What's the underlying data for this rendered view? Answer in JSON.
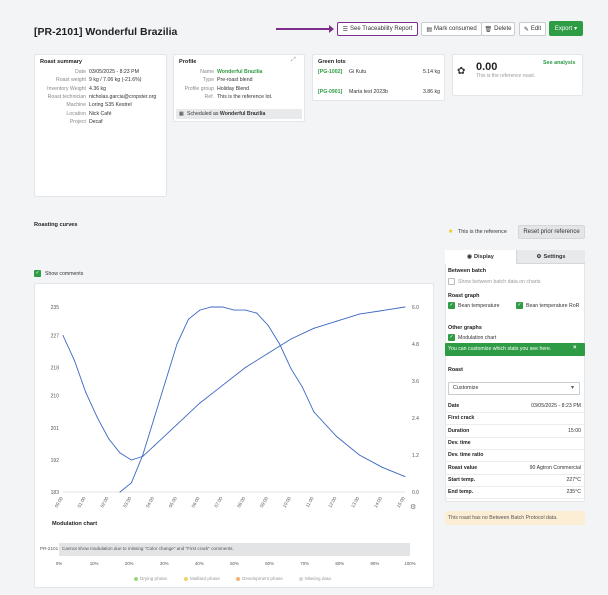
{
  "header": {
    "title": "[PR-2101] Wonderful Brazilia",
    "buttons": {
      "traceability": "See Traceability Report",
      "mark_consumed": "Mark consumed",
      "delete": "Delete",
      "edit": "Edit",
      "export": "Export"
    }
  },
  "roast_summary": {
    "title": "Roast summary",
    "rows": [
      {
        "key": "Date",
        "value": "03/05/2025 - 8:23 PM"
      },
      {
        "key": "Roast weight",
        "value": "9 kg / 7.06 kg (-21.6%)"
      },
      {
        "key": "Inventory Weight",
        "value": "4.36 kg"
      },
      {
        "key": "Roast technician",
        "value": "nicholas.garcia@cropster.org"
      },
      {
        "key": "Machine",
        "value": "Loring S35 Kestrel"
      },
      {
        "key": "Location",
        "value": "Nick Café"
      },
      {
        "key": "Project",
        "value": "Decaf"
      }
    ]
  },
  "profile": {
    "title": "Profile",
    "rows": [
      {
        "key": "Name",
        "value": "Wonderful Brazilia"
      },
      {
        "key": "Type",
        "value": "Pre-roast blend"
      },
      {
        "key": "Profile group",
        "value": "Holiday Blend"
      },
      {
        "key": "Ref.",
        "value": "This is the reference lot."
      }
    ],
    "scheduled_label": "Scheduled as",
    "scheduled_value": "Wonderful Brazilia"
  },
  "green_lots": {
    "title": "Green lots",
    "lots": [
      {
        "code": "[PG-1002]",
        "name": "Gi Kutu",
        "weight": "5.14 kg"
      },
      {
        "code": "[PG-0901]",
        "name": "Marta test 2023b",
        "weight": "3.86 kg"
      }
    ]
  },
  "analysis": {
    "score": "0.00",
    "note": "This is the reference roast.",
    "link": "See analysis"
  },
  "roasting": {
    "title": "Roasting curves",
    "reference_note": "This is the reference",
    "reset_button": "Reset prior reference",
    "show_comments": "Show comments"
  },
  "display_panel": {
    "tabs": {
      "display": "Display",
      "settings": "Settings"
    },
    "between_batch_title": "Between batch",
    "between_batch_option": "Show between batch data on charts",
    "roast_graph_title": "Roast graph",
    "bean_temp": "Bean temperature",
    "bean_temp_ror": "Bean temperature RoR",
    "other_graphs_title": "Other graphs",
    "modulation_chart": "Modulation chart",
    "tooltip": "You can customize which stats you see here.",
    "roast_title": "Roast",
    "customize_select": "Customize",
    "stats": [
      {
        "key": "Date",
        "value": "03/05/2025 - 8:23 PM"
      },
      {
        "key": "First crack",
        "value": ""
      },
      {
        "key": "Duration",
        "value": "15:00"
      },
      {
        "key": "Dev. time",
        "value": ""
      },
      {
        "key": "Dev. time ratio",
        "value": ""
      },
      {
        "key": "Roast value",
        "value": "90 Agtron Commercial"
      },
      {
        "key": "Start temp.",
        "value": "227°C"
      },
      {
        "key": "End temp.",
        "value": "235°C"
      }
    ],
    "between_batch_notice": "This roast has no Between Batch Protocol data."
  },
  "chart_data": [
    {
      "type": "line",
      "x_ticks": [
        "00:00",
        "01:00",
        "02:00",
        "03:00",
        "04:00",
        "05:00",
        "06:00",
        "07:00",
        "08:00",
        "09:00",
        "10:00",
        "11:00",
        "12:00",
        "13:00",
        "14:00",
        "15:00"
      ],
      "y_left_ticks": [
        "183",
        "192",
        "201",
        "210",
        "218",
        "227",
        "235"
      ],
      "y_right_ticks": [
        "0.0",
        "1.2",
        "2.4",
        "3.6",
        "4.8",
        "6.0"
      ],
      "y_left_range": [
        183,
        235
      ],
      "y_right_range": [
        0,
        6.0
      ],
      "x_range": [
        0,
        15
      ],
      "series": [
        {
          "axis": "left",
          "x": [
            0,
            0.5,
            1,
            1.5,
            2,
            2.5,
            3,
            3.5,
            4,
            5,
            6,
            7,
            8,
            9,
            10,
            11,
            12,
            13,
            14,
            15
          ],
          "y": [
            227,
            220,
            211,
            204,
            198,
            194,
            192,
            193,
            196,
            202,
            208,
            213,
            218,
            222,
            226,
            229,
            231,
            233,
            234,
            235
          ]
        },
        {
          "axis": "right",
          "x": [
            2.5,
            3,
            3.5,
            4,
            4.5,
            5,
            5.5,
            6,
            6.5,
            7,
            7.5,
            8,
            8.5,
            9,
            9.5,
            10,
            10.5,
            11,
            12,
            13,
            14,
            15
          ],
          "y": [
            0.0,
            0.3,
            1.2,
            2.4,
            3.6,
            4.8,
            5.6,
            5.9,
            6.0,
            6.0,
            5.9,
            5.9,
            5.8,
            5.4,
            4.8,
            4.0,
            3.4,
            2.6,
            1.8,
            1.2,
            0.8,
            0.5
          ]
        }
      ]
    },
    {
      "type": "bar",
      "title": "Modulation chart",
      "row_label": "PR-2101",
      "message": "Cannot show modulation due to missing \"Color change\" and \"First crack\" comments.",
      "x_ticks": [
        "0%",
        "10%",
        "20%",
        "30%",
        "40%",
        "50%",
        "60%",
        "70%",
        "80%",
        "90%",
        "100%"
      ],
      "legend": [
        "Drying phase",
        "Maillard phase",
        "Development phase",
        "Missing data"
      ],
      "legend_colors": [
        "#9ad67f",
        "#f2d16b",
        "#f2b27a",
        "#d6d6d6"
      ]
    }
  ]
}
